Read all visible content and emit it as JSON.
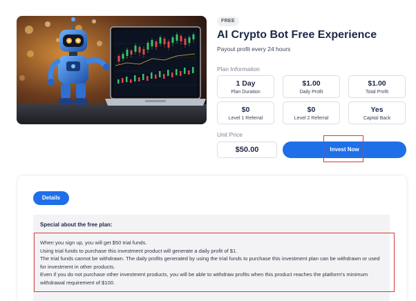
{
  "product": {
    "badge": "FREE",
    "title": "AI Crypto Bot Free Experience",
    "subtitle": "Payout profit every 24 hours"
  },
  "plan_info": {
    "label": "Plan Information",
    "items": [
      {
        "value": "1 Day",
        "label": "Plan Duration"
      },
      {
        "value": "$1.00",
        "label": "Daily Profit"
      },
      {
        "value": "$1.00",
        "label": "Total Profit"
      },
      {
        "value": "$0",
        "label": "Level 1 Referral"
      },
      {
        "value": "$0",
        "label": "Level 2 Referral"
      },
      {
        "value": "Yes",
        "label": "Capital Back"
      }
    ]
  },
  "unit_price": {
    "label": "Unit Price",
    "value": "$50.00"
  },
  "invest_button": "Invest Now",
  "details": {
    "tab_label": "Details",
    "special_title": "Special about the free plan:",
    "lines": [
      "When you sign up, you will get $50 trial funds.",
      "Using trial funds to purchase this investment product will generate a daily profit of $1.",
      "The trial funds cannot be withdrawn. The daily profits generated by using the trial funds to purchase this investment plan can be withdrawn or used for investment in other products.",
      "Even if you do not purchase other investment products, you will be able to withdraw profits when this product reaches the platform's minimum withdrawal requirement of $100."
    ]
  },
  "colors": {
    "accent": "#1f6fe8",
    "highlight": "#d33a3a",
    "title": "#1c2847"
  }
}
